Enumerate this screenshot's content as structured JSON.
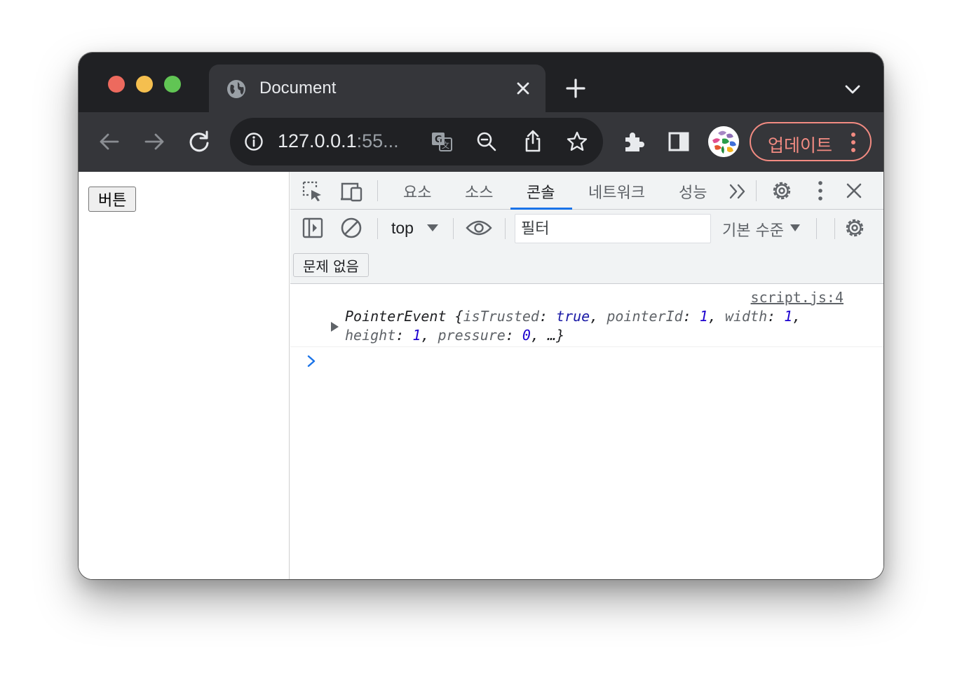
{
  "browser": {
    "tab_title": "Document",
    "url_host": "127.0.0.1",
    "url_rest": ":55...",
    "update_label": "업데이트"
  },
  "page": {
    "button_label": "버튼"
  },
  "devtools": {
    "tabs": [
      "요소",
      "소스",
      "콘솔",
      "네트워크",
      "성능"
    ],
    "active_tab": "콘솔",
    "context": "top",
    "filter_placeholder": "필터",
    "level": "기본 수준",
    "issues_label": "문제 없음",
    "log": {
      "source": "script.js:4",
      "class_name": "PointerEvent",
      "fields": [
        {
          "key": "isTrusted",
          "value": "true"
        },
        {
          "key": "pointerId",
          "value": "1"
        },
        {
          "key": "width",
          "value": "1"
        },
        {
          "key": "height",
          "value": "1"
        },
        {
          "key": "pressure",
          "value": "0"
        }
      ],
      "ellipsis": "…"
    }
  },
  "colors": {
    "accent": "#1a73e8",
    "update": "#f28b82",
    "frame": "#202124",
    "toolbar": "#35363a"
  }
}
